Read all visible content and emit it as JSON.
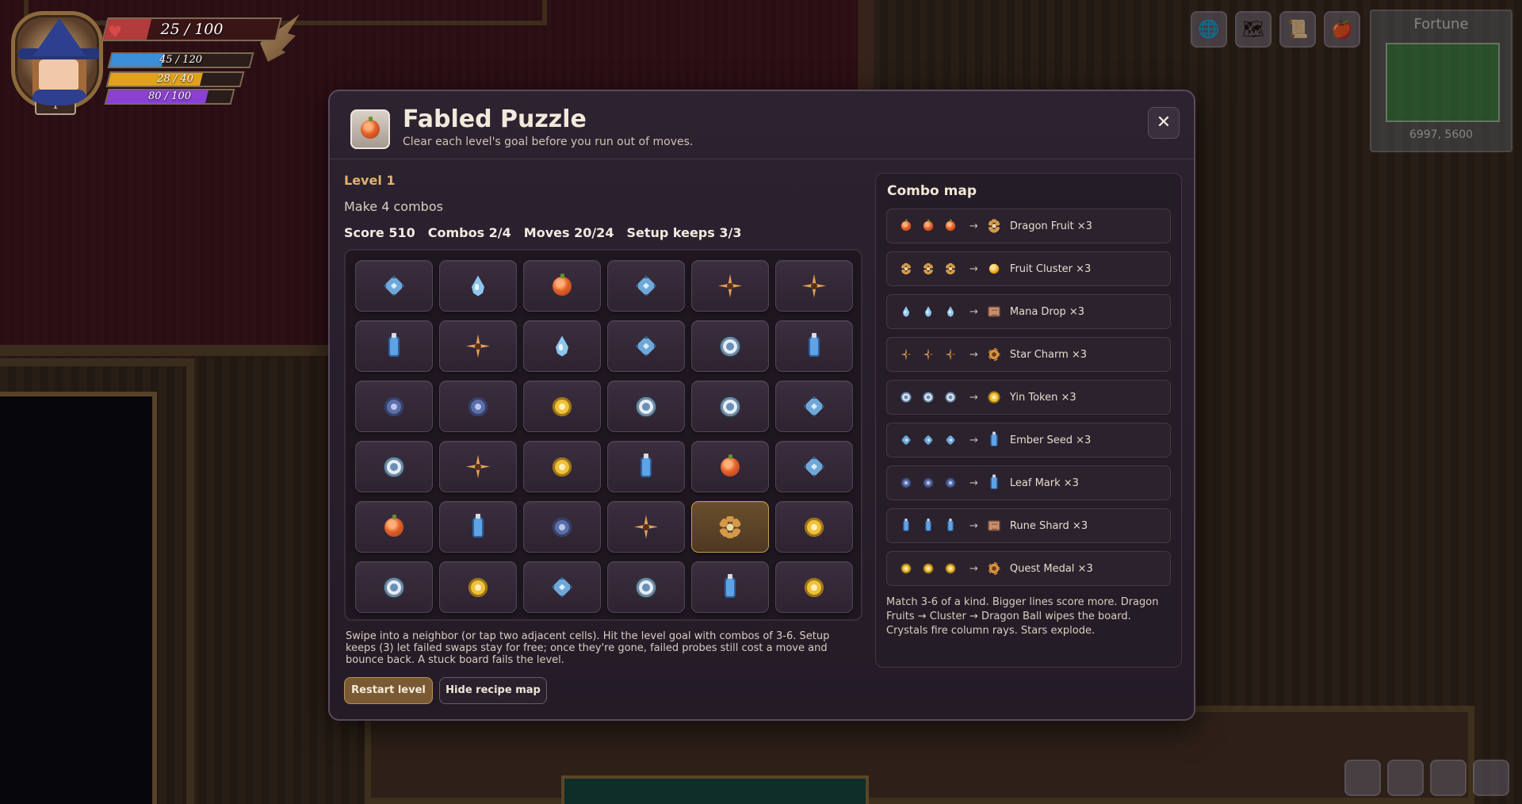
{
  "hud": {
    "hp": "25 / 100",
    "hp_fraction": 0.25,
    "mp": "45 / 120",
    "mp_fraction": 0.375,
    "energy": "28 / 40",
    "energy_fraction": 0.7,
    "xp": "80 / 100",
    "xp_fraction": 0.8,
    "level": "1"
  },
  "minimap": {
    "title": "Fortune",
    "coords": "6997, 5600"
  },
  "modal": {
    "title": "Fabled Puzzle",
    "subtitle": "Clear each level's goal before you run out of moves.",
    "close_label": "✕",
    "level": "Level 1",
    "goal": "Make 4 combos",
    "stats": {
      "score": "Score 510",
      "combos": "Combos 2/4",
      "moves": "Moves 20/24",
      "setup": "Setup keeps 3/3"
    },
    "board": [
      [
        "crystal",
        "drop",
        "fruit",
        "crystal",
        "star",
        "star"
      ],
      [
        "bottle",
        "star",
        "drop",
        "crystal",
        "yin",
        "bottle"
      ],
      [
        "leaf",
        "leaf",
        "medal",
        "yin",
        "yin",
        "crystal"
      ],
      [
        "yin",
        "star",
        "medal",
        "bottle",
        "fruit",
        "crystal"
      ],
      [
        "fruit",
        "bottle",
        "leaf",
        "star",
        "cluster",
        "medal"
      ],
      [
        "yin",
        "medal",
        "crystal",
        "yin",
        "bottle",
        "medal"
      ]
    ],
    "selected_cell": "4-4",
    "help": "Swipe into a neighbor (or tap two adjacent cells). Hit the level goal with combos of 3-6. Setup keeps (3) let failed swaps stay for free; once they're gone, failed probes still cost a move and bounce back. A stuck board fails the level.",
    "buttons": {
      "restart": "Restart level",
      "hide": "Hide recipe map"
    },
    "combo_map": {
      "title": "Combo map",
      "rows": [
        {
          "ingredient": "fruit",
          "result": "cluster",
          "label": "Dragon Fruit ×3"
        },
        {
          "ingredient": "cluster",
          "result": "goldfruit",
          "label": "Fruit Cluster ×3"
        },
        {
          "ingredient": "drop",
          "result": "scroll",
          "label": "Mana Drop ×3"
        },
        {
          "ingredient": "star",
          "result": "sunflower",
          "label": "Star Charm ×3"
        },
        {
          "ingredient": "yin",
          "result": "medal",
          "label": "Yin Token ×3"
        },
        {
          "ingredient": "crystal",
          "result": "bottle",
          "label": "Ember Seed ×3"
        },
        {
          "ingredient": "leaf",
          "result": "bottle",
          "label": "Leaf Mark ×3"
        },
        {
          "ingredient": "bottle",
          "result": "scroll",
          "label": "Rune Shard ×3"
        },
        {
          "ingredient": "medal",
          "result": "sunflower",
          "label": "Quest Medal ×3"
        }
      ],
      "footer": "Match 3-6 of a kind. Bigger lines score more. Dragon Fruits → Cluster → Dragon Ball wipes the board. Crystals fire column rays. Stars explode."
    }
  },
  "icons": {
    "fruit": "dragon-fruit-icon",
    "cluster": "fruit-cluster-icon",
    "drop": "mana-drop-icon",
    "star": "star-charm-icon",
    "yin": "yin-token-icon",
    "crystal": "crystal-icon",
    "leaf": "leaf-mark-icon",
    "bottle": "rune-bottle-icon",
    "medal": "quest-medal-icon",
    "goldfruit": "gold-fruit-icon",
    "scroll": "scroll-icon",
    "sunflower": "sun-charm-icon"
  }
}
